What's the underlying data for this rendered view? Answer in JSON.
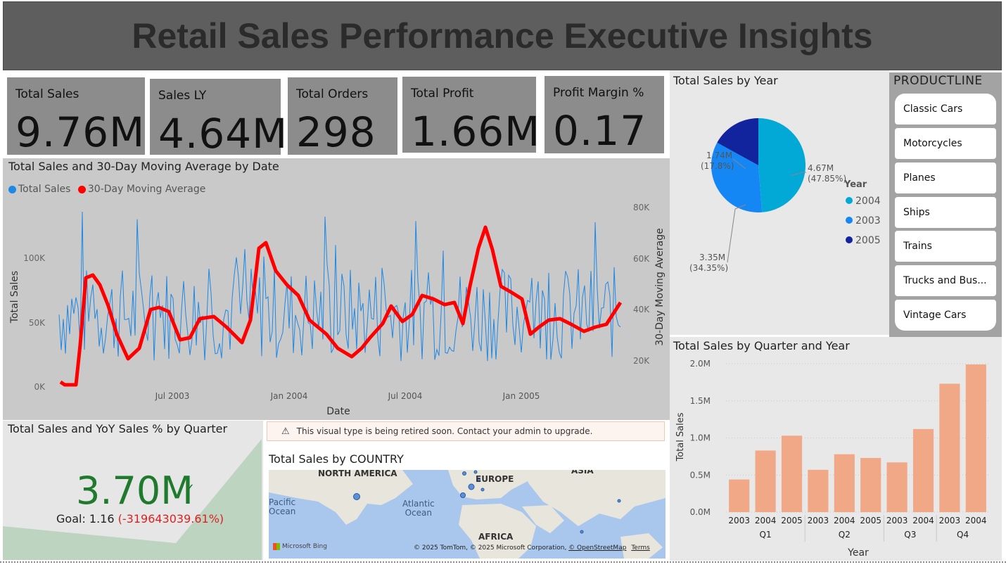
{
  "dashboard": {
    "title": "Retail Sales Performance Executive Insights"
  },
  "kpis": [
    {
      "label": "Total Sales",
      "value": "9.76M"
    },
    {
      "label": "Sales LY",
      "value": "4.64M"
    },
    {
      "label": "Total Orders",
      "value": "298"
    },
    {
      "label": "Total Profit",
      "value": "1.66M"
    },
    {
      "label": "Profit Margin %",
      "value": "0.17"
    }
  ],
  "trend": {
    "title": "Total Sales and 30-Day Moving Average by Date",
    "legend": [
      "Total Sales",
      "30-Day Moving Average"
    ],
    "colors": {
      "sales": "#1e88e5",
      "ma": "#ff0000"
    },
    "xlabel": "Date",
    "ylabel_left": "Total Sales",
    "ylabel_right": "30-Day Moving Average",
    "left_ticks": [
      "0K",
      "50K",
      "100K"
    ],
    "right_ticks": [
      "20K",
      "40K",
      "60K",
      "80K"
    ],
    "x_ticks": [
      "Jul 2003",
      "Jan 2004",
      "Jul 2004",
      "Jan 2005"
    ]
  },
  "pie": {
    "title": "Total Sales by Year",
    "legend_title": "Year",
    "label_2004": "4.67M",
    "pct_2004": "(47.85%)",
    "label_2003": "3.35M",
    "pct_2003": "(34.35%)",
    "label_2005": "1.74M",
    "pct_2005": "(17.8%)"
  },
  "slicer": {
    "title": "PRODUCTLINE",
    "items": [
      "Classic Cars",
      "Motorcycles",
      "Planes",
      "Ships",
      "Trains",
      "Trucks and Bus...",
      "Vintage Cars"
    ]
  },
  "gauge": {
    "title": "Total Sales and YoY Sales % by Quarter",
    "value": "3.70M",
    "check": "✓",
    "goal_label": "Goal: 1.16",
    "goal_delta": "(-319643039.61%)",
    "colors": {
      "value": "#1f7a2e",
      "delta": "#e02020"
    }
  },
  "map": {
    "warning": "This visual type is being retired soon. Contact your admin to upgrade.",
    "title": "Total Sales by COUNTRY",
    "labels": {
      "north_america": "NORTH AMERICA",
      "europe": "EUROPE",
      "asia": "ASIA",
      "africa": "AFRICA",
      "pacific": "Pacific",
      "pacific2": "Ocean",
      "atlantic": "Atlantic",
      "atlantic2": "Ocean",
      "bing": "Microsoft Bing",
      "copyright": "© 2025 TomTom, © 2025 Microsoft Corporation,",
      "osm": "© OpenStreetMap",
      "terms": "Terms"
    }
  },
  "chart_data": [
    {
      "type": "pie",
      "title": "Total Sales by Year",
      "categories": [
        "2004",
        "2003",
        "2005"
      ],
      "values": [
        4.67,
        3.35,
        1.74
      ],
      "percent": [
        47.85,
        34.35,
        17.8
      ],
      "colors": [
        "#02a9d6",
        "#1587f5",
        "#12239e"
      ],
      "legend": "right"
    },
    {
      "type": "bar",
      "title": "Total Sales by Quarter and Year",
      "xlabel": "Year",
      "ylabel": "Total Sales",
      "categories": [
        "2003",
        "2004",
        "2005",
        "2003",
        "2004",
        "2005",
        "2003",
        "2004",
        "2003",
        "2004"
      ],
      "groups": [
        "Q1",
        "Q2",
        "Q3",
        "Q4"
      ],
      "group_sizes": [
        3,
        3,
        2,
        2
      ],
      "values": [
        0.44,
        0.83,
        1.03,
        0.57,
        0.78,
        0.73,
        0.67,
        1.12,
        1.73,
        1.99
      ],
      "y_ticks": [
        "0.0M",
        "0.5M",
        "1.0M",
        "1.5M",
        "2.0M"
      ],
      "ylim": [
        0,
        2.0
      ],
      "color": "#f0a886",
      "grid": true
    }
  ]
}
